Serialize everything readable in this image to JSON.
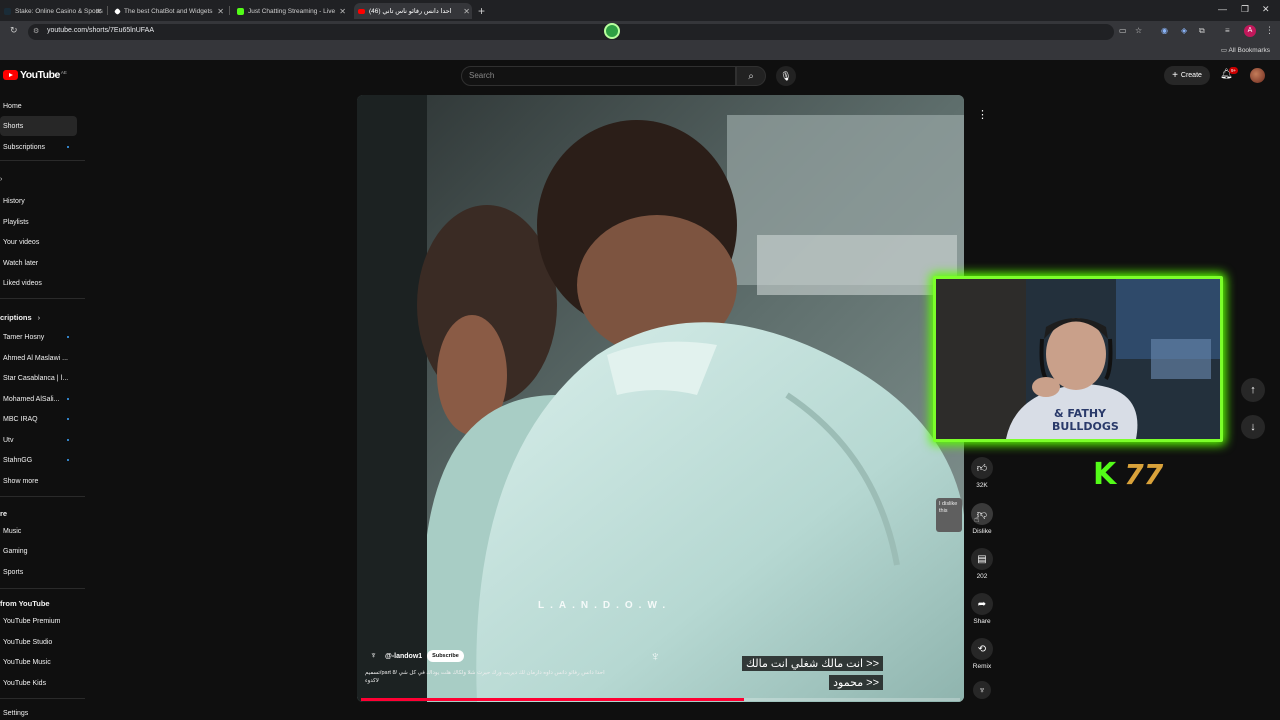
{
  "browser": {
    "tabs": [
      {
        "title": "Stake: Online Casino & Sports",
        "icon_color": "#1a2c38"
      },
      {
        "title": "The best ChatBot and Widgets",
        "icon_color": "#ffffff"
      },
      {
        "title": "Just Chatting Streaming - Live",
        "icon_color": "#53fc18"
      },
      {
        "title": "(46) احدا دانس رفائو ناس تاني",
        "icon_color": "#ff0000",
        "active": true
      }
    ],
    "url": "youtube.com/shorts/7Eu65lnUFAA",
    "all_bookmarks": "All Bookmarks",
    "avatar_letter": "A"
  },
  "youtube": {
    "logo_text": "YouTube",
    "country": "AE",
    "search_placeholder": "Search",
    "create_label": "Create",
    "notif_count": "9+"
  },
  "sidebar": {
    "main": [
      {
        "label": "Home"
      },
      {
        "label": "Shorts",
        "active": true
      },
      {
        "label": "Subscriptions",
        "dot": true
      }
    ],
    "you": [
      {
        "label": "History"
      },
      {
        "label": "Playlists"
      },
      {
        "label": "Your videos"
      },
      {
        "label": "Watch later"
      },
      {
        "label": "Liked videos"
      }
    ],
    "subscriptions_heading": "criptions",
    "subscriptions": [
      {
        "label": "Tamer Hosny",
        "dot": true
      },
      {
        "label": "Ahmed Al Maslawi ...",
        "dot": false
      },
      {
        "label": "Star Casablanca | ا...",
        "dot": false
      },
      {
        "label": "Mohamed AlSali...",
        "dot": true
      },
      {
        "label": "MBC IRAQ",
        "dot": true
      },
      {
        "label": "Utv",
        "dot": true
      },
      {
        "label": "StahnGG",
        "dot": true
      },
      {
        "label": "Show more",
        "dot": false
      }
    ],
    "explore_heading": "re",
    "explore": [
      {
        "label": "Music"
      },
      {
        "label": "Gaming"
      },
      {
        "label": "Sports"
      }
    ],
    "more_heading": "from YouTube",
    "more": [
      {
        "label": "YouTube Premium"
      },
      {
        "label": "YouTube Studio"
      },
      {
        "label": "YouTube Music"
      },
      {
        "label": "YouTube Kids"
      }
    ],
    "settings": "Settings"
  },
  "short": {
    "channel": "@-landow1",
    "subscribe": "Subscribe",
    "description": "احدا دانس رفائو دانس داوه دارمان لك ديريت ورك حيرت شلا ولكاك هلت يوداك في كل شي /part 8/تسميم لاكدوء",
    "caption_line1": "<< انت مالك شغلي انت مالك",
    "caption_line2": "<< محمود",
    "watermark": "L.A.N.D.O.W.",
    "progress": 0.64,
    "like_count": "32K",
    "dislike_label": "Dislike",
    "comment_count": "202",
    "share_label": "Share",
    "remix_label": "Remix",
    "tooltip": "I dislike this"
  },
  "overlay": {
    "kick_letter": "K",
    "viewer_count": "77",
    "frame_color": "#7cff2a"
  }
}
